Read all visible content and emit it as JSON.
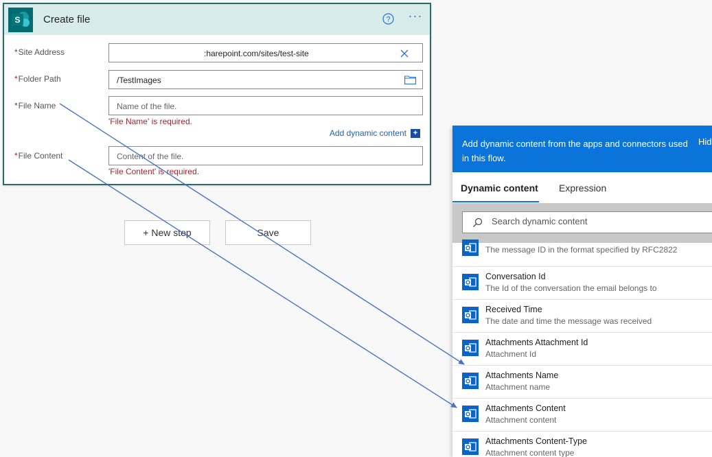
{
  "card": {
    "logo_letter": "S",
    "title": "Create file",
    "help_icon": "help-circle-icon",
    "more_icon": "more-dots-icon",
    "required_mark": "*",
    "fields": {
      "site_address": {
        "label": "Site Address",
        "value": ":harepoint.com/sites/test-site"
      },
      "folder_path": {
        "label": "Folder Path",
        "value": "/TestImages"
      },
      "file_name": {
        "label": "File Name",
        "placeholder": "Name of the file.",
        "error": "'File Name' is required."
      },
      "file_content": {
        "label": "File Content",
        "placeholder": "Content of the file.",
        "error": "'File Content' is required."
      }
    },
    "add_dynamic": "Add dynamic content",
    "add_dynamic_plus": "+"
  },
  "buttons": {
    "new_step": "+ New step",
    "save": "Save"
  },
  "panel": {
    "header_text": "Add dynamic content from the apps and connectors used in this flow.",
    "hide": "Hid",
    "tabs": {
      "dynamic": "Dynamic content",
      "expression": "Expression"
    },
    "search_placeholder": "Search dynamic content",
    "partial_item_desc": "The message ID in the format specified by RFC2822",
    "items": [
      {
        "name": "Conversation Id",
        "desc": "The Id of the conversation the email belongs to"
      },
      {
        "name": "Received Time",
        "desc": "The date and time the message was received"
      },
      {
        "name": "Attachments Attachment Id",
        "desc": "Attachment Id"
      },
      {
        "name": "Attachments Name",
        "desc": "Attachment name"
      },
      {
        "name": "Attachments Content",
        "desc": "Attachment content"
      },
      {
        "name": "Attachments Content-Type",
        "desc": "Attachment content type"
      }
    ]
  },
  "colors": {
    "accent": "#0a74da",
    "error": "#a4262c",
    "card_header": "#d9ecec",
    "outlook_icon": "#0a64c8",
    "arrow": "#4a72c4"
  }
}
